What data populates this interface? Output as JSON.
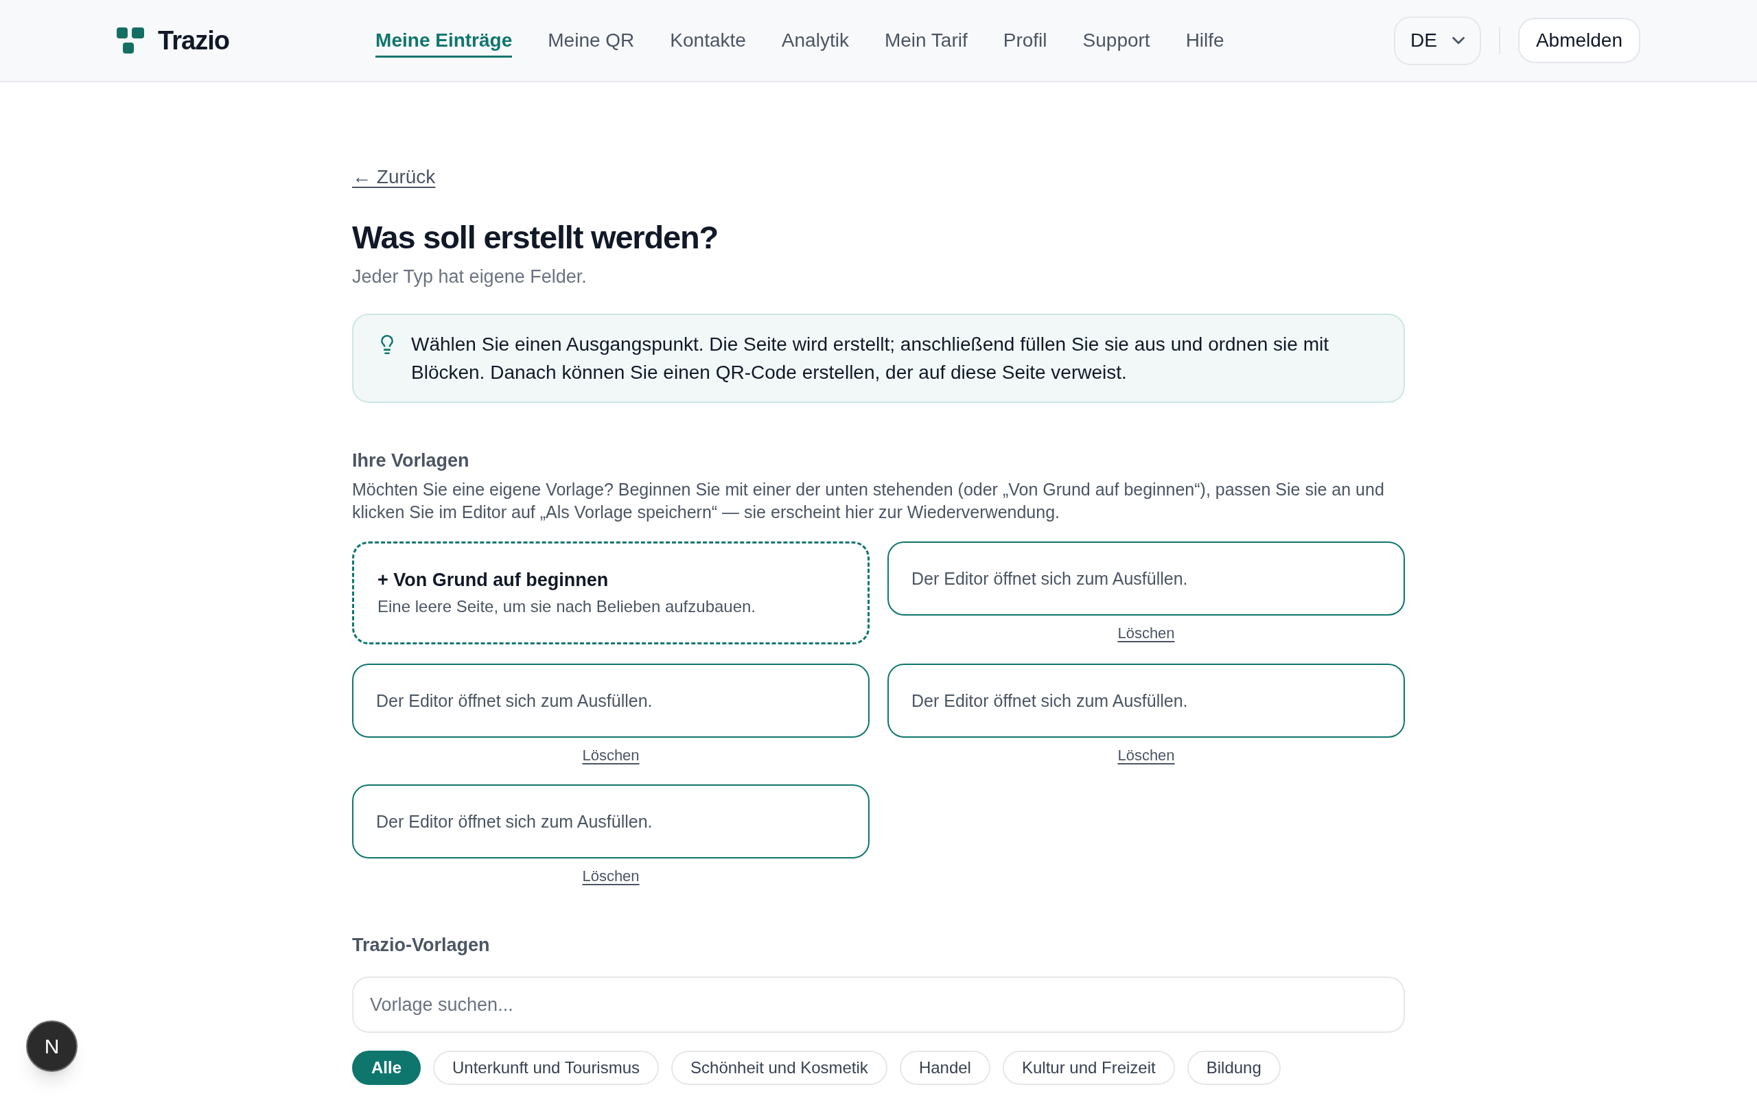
{
  "header": {
    "logo": "Trazio",
    "nav": [
      {
        "label": "Meine Einträge",
        "selected": true
      },
      {
        "label": "Meine QR",
        "selected": false
      },
      {
        "label": "Kontakte",
        "selected": false
      },
      {
        "label": "Analytik",
        "selected": false
      },
      {
        "label": "Mein Tarif",
        "selected": false
      },
      {
        "label": "Profil",
        "selected": false
      },
      {
        "label": "Support",
        "selected": false
      },
      {
        "label": "Hilfe",
        "selected": false
      }
    ],
    "language": "DE",
    "logout": "Abmelden"
  },
  "back_link": "← Zurück",
  "title": "Was soll erstellt werden?",
  "subtitle": "Jeder Typ hat eigene Felder.",
  "info": "Wählen Sie einen Ausgangspunkt. Die Seite wird erstellt; anschließend füllen Sie sie aus und ordnen sie mit Blöcken. Danach können Sie einen QR-Code erstellen, der auf diese Seite verweist.",
  "own_templates": {
    "heading": "Ihre Vorlagen",
    "description": "Möchten Sie eine eigene Vorlage? Beginnen Sie mit einer der unten stehenden (oder „Von Grund auf beginnen“), passen Sie sie an und klicken Sie im Editor auf „Als Vorlage speichern“ — sie erscheint hier zur Wiederverwendung.",
    "cards": [
      {
        "kind": "blank",
        "title": "+ Von Grund auf beginnen",
        "description": "Eine leere Seite, um sie nach Belieben aufzubauen."
      },
      {
        "kind": "template",
        "description": "Der Editor öffnet sich zum Ausfüllen.",
        "delete": "Löschen"
      },
      {
        "kind": "template",
        "description": "Der Editor öffnet sich zum Ausfüllen.",
        "delete": "Löschen"
      },
      {
        "kind": "template",
        "description": "Der Editor öffnet sich zum Ausfüllen.",
        "delete": "Löschen"
      },
      {
        "kind": "template",
        "description": "Der Editor öffnet sich zum Ausfüllen.",
        "delete": "Löschen"
      }
    ]
  },
  "trazio_templates": {
    "heading": "Trazio-Vorlagen",
    "search": {
      "placeholder": "Vorlage suchen..."
    },
    "filters": [
      {
        "label": "Alle",
        "selected": true
      },
      {
        "label": "Unterkunft und Tourismus",
        "selected": false
      },
      {
        "label": "Schönheit und Kosmetik",
        "selected": false
      },
      {
        "label": "Handel",
        "selected": false
      },
      {
        "label": "Kultur und Freizeit",
        "selected": false
      },
      {
        "label": "Bildung",
        "selected": false
      }
    ]
  },
  "dev_badge": {
    "label": "N"
  }
}
